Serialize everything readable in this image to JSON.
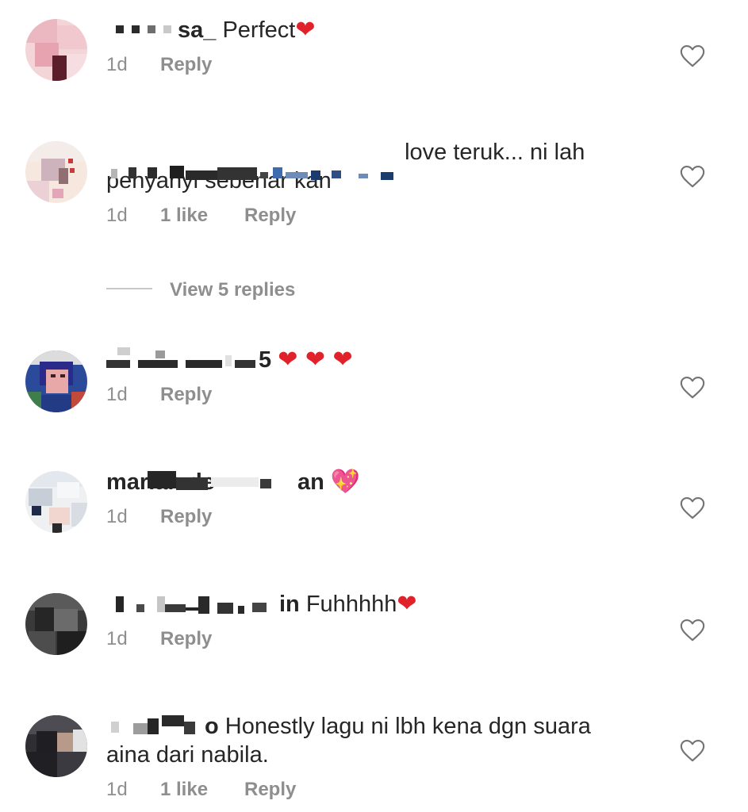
{
  "comments": [
    {
      "username": "sa_",
      "text": "Perfect",
      "emoji": "❤",
      "time": "1d",
      "reply_label": "Reply"
    },
    {
      "username": "love",
      "text_line1": "teruk... ni lah",
      "text_line2": "penyanyi sebenar kan",
      "time": "1d",
      "likes": "1 like",
      "reply_label": "Reply"
    },
    {
      "username": "5",
      "emoji": "❤ ❤ ❤",
      "time": "1d",
      "reply_label": "Reply"
    },
    {
      "username": "mariah.de",
      "username_end": "an",
      "emoji": "💖",
      "time": "1d",
      "reply_label": "Reply"
    },
    {
      "username": "in",
      "text": "Fuhhhhh",
      "emoji": "❤",
      "time": "1d",
      "reply_label": "Reply"
    },
    {
      "username": "o",
      "text_line1": "Honestly lagu ni lbh kena dgn suara",
      "text_line2": "aina dari nabila.",
      "time": "1d",
      "likes": "1 like",
      "reply_label": "Reply"
    }
  ],
  "view_replies": {
    "label": "View 5 replies"
  },
  "icons": {
    "like": "heart-outline-icon"
  },
  "colors": {
    "primary_text": "#262626",
    "secondary_text": "#8e8e8e",
    "heart_emoji": "#e0222b"
  }
}
